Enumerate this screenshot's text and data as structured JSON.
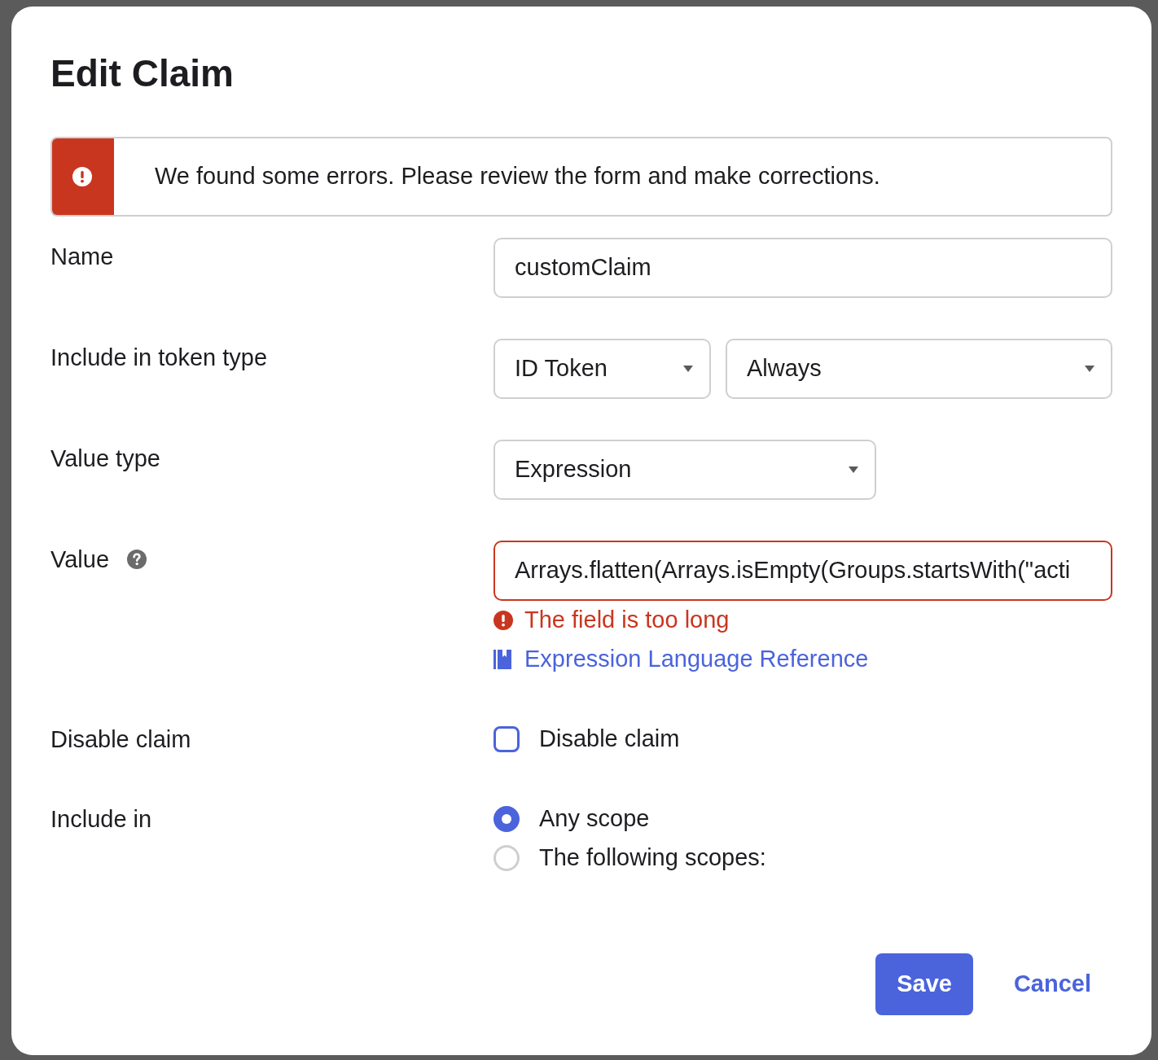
{
  "dialog": {
    "title": "Edit Claim"
  },
  "alert": {
    "message": "We found some errors. Please review the form and make corrections."
  },
  "fields": [
    {
      "kind": "text",
      "label": "Name",
      "value": "customClaim",
      "invalid": false
    },
    {
      "kind": "select_pair",
      "label": "Include in token type",
      "selects": [
        {
          "value": "ID Token"
        },
        {
          "value": "Always"
        }
      ]
    },
    {
      "kind": "select",
      "label": "Value type",
      "value": "Expression"
    },
    {
      "kind": "text",
      "label": "Value",
      "help": true,
      "value": "Arrays.flatten(Arrays.isEmpty(Groups.startsWith(\"acti",
      "invalid": true,
      "error": "The field is too long",
      "link": "Expression Language Reference"
    },
    {
      "kind": "checkbox",
      "label": "Disable claim",
      "option": "Disable claim",
      "checked": false
    },
    {
      "kind": "radio",
      "label": "Include in",
      "options": [
        {
          "label": "Any scope",
          "selected": true
        },
        {
          "label": "The following scopes:",
          "selected": false
        }
      ]
    }
  ],
  "buttons": [
    {
      "kind": "primary",
      "label": "Save"
    },
    {
      "kind": "link",
      "label": "Cancel"
    }
  ]
}
